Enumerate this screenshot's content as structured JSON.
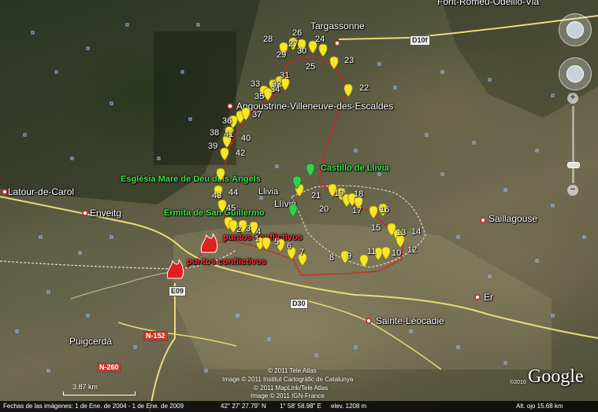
{
  "places": {
    "targassonne": "Targassonne",
    "angoustrine": "Angoustrine-Villeneuve-des-Escaldes",
    "latour": "Latour-de-Carol",
    "enveitg": "Enveitg",
    "llivia_main": "Llívia",
    "llivia_small": "Llivia",
    "saillagouse": "Saillagouse",
    "sainte_leocadie": "Sainte-Léocadie",
    "puigcerda": "Puigcerdà",
    "er": "Er",
    "font_romeu": "Font-Romeu-Odeillo-Via"
  },
  "placemarks_green": {
    "castillo": "Castillo de Llivia",
    "esglesia": "Esglèsia Mare de Deu dels Àngels",
    "ermita": "Ermita de San Guillermo"
  },
  "conflict_label": "puntos conflictivos",
  "roads": {
    "d10f": "D10f",
    "e09": "E09",
    "d30": "D30",
    "n152": "N-152",
    "n260": "N-260"
  },
  "waypoint_numbers": [
    "1",
    "2",
    "3",
    "4",
    "5",
    "6",
    "7",
    "8",
    "9",
    "10",
    "11",
    "12",
    "13",
    "14",
    "15",
    "16",
    "17",
    "18",
    "19",
    "20",
    "21",
    "22",
    "23",
    "24",
    "25",
    "26",
    "27",
    "28",
    "29",
    "30",
    "31",
    "32",
    "33",
    "34",
    "35",
    "36",
    "37",
    "38",
    "39",
    "40",
    "41",
    "42",
    "43",
    "44",
    "45"
  ],
  "scale": "3.87 km",
  "credits": {
    "c1": "© 2011 Tele Atlas",
    "c2": "Image © 2011 Institut Cartogràfic de Catalunya",
    "c3": "© 2011 MapLink/Tele Atlas",
    "c4": "Image © 2011 IGN-France"
  },
  "logo": "Google",
  "logo_year": "©2010",
  "status": {
    "dates": "Fechas de las imágenes: 1 de Ene. de 2004 - 1 de Ene. de 2009",
    "lat": "42° 27' 27.79\" N",
    "lon": "1° 58' 58.98\" E",
    "elev": "elev. 1208 m",
    "alt": "Alt. ojo   15.68 km"
  },
  "colors": {
    "route": "#d81e1e",
    "pin_yellow": "#f7e627",
    "pin_green": "#35d04a",
    "conflict": "#e02020",
    "border_line": "#ffffff",
    "road": "#e9d97a"
  }
}
